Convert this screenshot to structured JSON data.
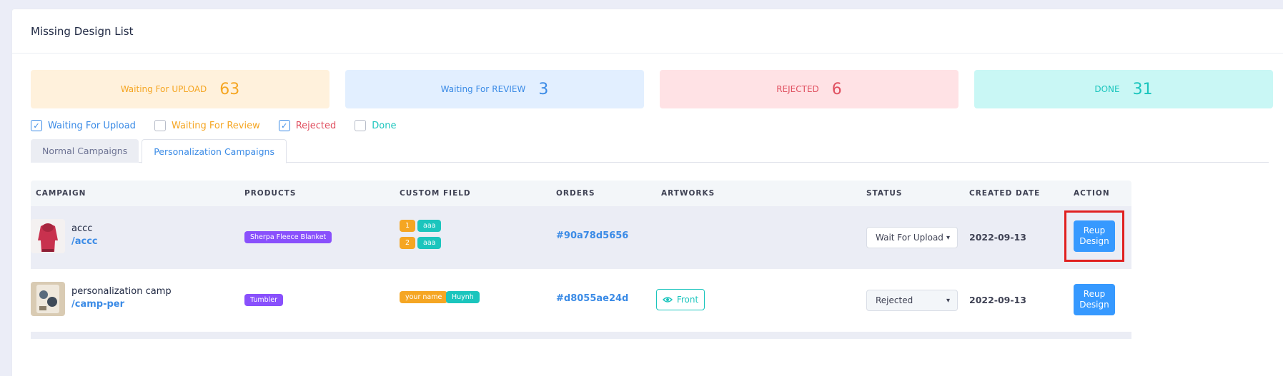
{
  "card": {
    "title": "Missing Design List"
  },
  "stats": {
    "upload": {
      "prefix": "Waiting For",
      "label": "UPLOAD",
      "count": "63"
    },
    "review": {
      "prefix": "Waiting For",
      "label": "REVIEW",
      "count": "3"
    },
    "rejected": {
      "label": "REJECTED",
      "count": "6"
    },
    "done": {
      "label": "DONE",
      "count": "31"
    }
  },
  "filters": [
    {
      "label": "Waiting For Upload",
      "checked": true
    },
    {
      "label": "Waiting For Review",
      "checked": false
    },
    {
      "label": "Rejected",
      "checked": true
    },
    {
      "label": "Done",
      "checked": false
    }
  ],
  "tabs": [
    {
      "label": "Normal Campaigns",
      "active": false
    },
    {
      "label": "Personalization Campaigns",
      "active": true
    }
  ],
  "table": {
    "headers": [
      "CAMPAIGN",
      "PRODUCTS",
      "CUSTOM FIELD",
      "ORDERS",
      "ARTWORKS",
      "STATUS",
      "CREATED DATE",
      "ACTION"
    ],
    "rows": [
      {
        "name": "accc",
        "slug": "/accc",
        "product": "Sherpa Fleece Blanket",
        "custom_fields": [
          {
            "key": "1",
            "value": "aaa"
          },
          {
            "key": "2",
            "value": "aaa"
          }
        ],
        "order": "#90a78d5656",
        "artwork": "",
        "status": "Wait For Upload",
        "created": "2022-09-13",
        "action": "Reup Design"
      },
      {
        "name": "personalization camp",
        "slug": "/camp-per",
        "product": "Tumbler",
        "custom_fields": [
          {
            "key": "your name",
            "value": "Huynh"
          }
        ],
        "order": "#d8055ae24d",
        "artwork": "Front",
        "status": "Rejected",
        "created": "2022-09-13",
        "action": "Reup Design"
      }
    ]
  },
  "colors": {
    "upload": "#f5a623",
    "review": "#3b8be6",
    "rejected": "#e04f5f",
    "done": "#1bc5bd",
    "primary_button": "#3699ff",
    "highlight": "#e02020"
  },
  "icons": {
    "checkbox_checked": "check-icon",
    "select": "chevron-down-icon",
    "artwork": "eye-icon"
  }
}
